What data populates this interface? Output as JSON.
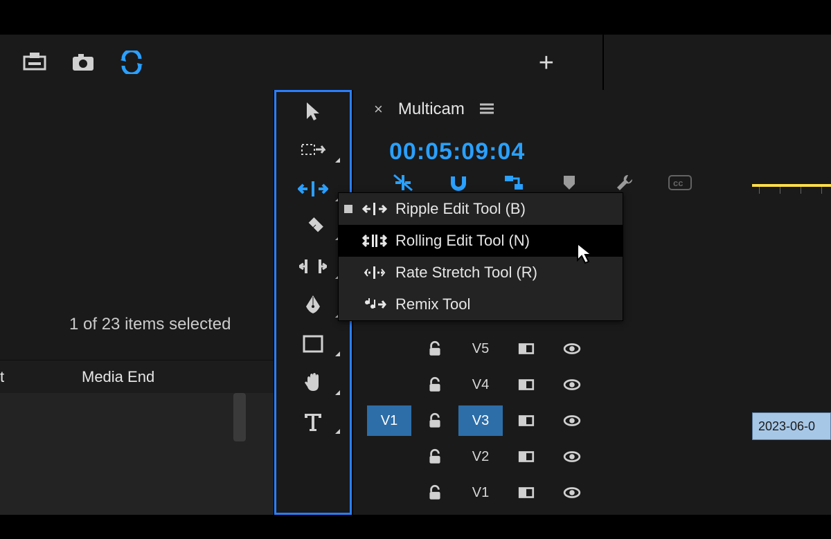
{
  "toolbar": {
    "icons": [
      "tray-icon",
      "camera-icon",
      "sync-icon"
    ],
    "plus": "+"
  },
  "leftPanel": {
    "selectionText": "1 of 23 items selected",
    "columns": [
      "t",
      "Media End"
    ]
  },
  "tools": [
    {
      "name": "selection-tool"
    },
    {
      "name": "track-select-tool"
    },
    {
      "name": "ripple-edit-tool",
      "active": true
    },
    {
      "name": "razor-tool"
    },
    {
      "name": "slip-tool"
    },
    {
      "name": "pen-tool"
    },
    {
      "name": "rectangle-tool"
    },
    {
      "name": "hand-tool"
    },
    {
      "name": "type-tool"
    }
  ],
  "sequence": {
    "tabName": "Multicam",
    "timecode": "00:05:09:04"
  },
  "toolMenu": {
    "items": [
      {
        "label": "Ripple Edit Tool (B)",
        "icon": "ripple-icon",
        "selected": true,
        "hover": false
      },
      {
        "label": "Rolling Edit Tool (N)",
        "icon": "rolling-icon",
        "selected": false,
        "hover": true
      },
      {
        "label": "Rate Stretch Tool (R)",
        "icon": "rate-stretch-icon",
        "selected": false,
        "hover": false
      },
      {
        "label": "Remix Tool",
        "icon": "remix-icon",
        "selected": false,
        "hover": false
      }
    ]
  },
  "tracks": [
    {
      "source": "",
      "label": "V5"
    },
    {
      "source": "",
      "label": "V4"
    },
    {
      "source": "V1",
      "label": "V3",
      "targeted": true
    },
    {
      "source": "",
      "label": "V2"
    },
    {
      "source": "",
      "label": "V1"
    }
  ],
  "clip": {
    "name": "2023-06-0"
  }
}
